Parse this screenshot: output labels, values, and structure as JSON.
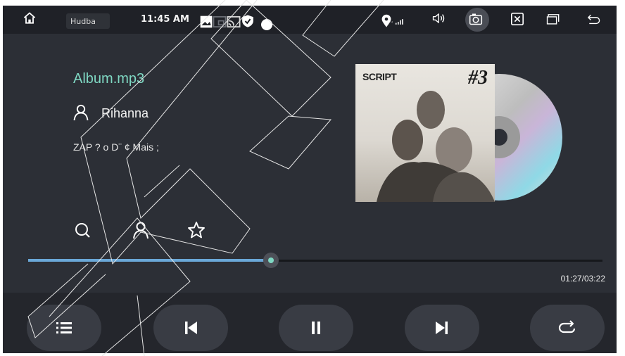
{
  "status_bar": {
    "app_label": "Hudba",
    "time": "11:45 AM",
    "icons": [
      "home-icon",
      "image-icon",
      "cast-icon",
      "screen-mirror-icon",
      "shield-icon",
      "location-icon",
      "signal-icon",
      "volume-icon",
      "camera-icon",
      "close-box-icon",
      "windows-icon",
      "back-icon"
    ]
  },
  "track": {
    "filename": "Album.mp3",
    "artist": "Rihanna",
    "album": "ZAP ? o D¨ ¢ Mais ;"
  },
  "cover": {
    "brand": "SCRIPT",
    "number": "#3"
  },
  "progress": {
    "fraction": 0.4226,
    "elapsed_total": "01:27/03:22"
  },
  "tools": [
    "search-icon",
    "artist-icon",
    "favorite-icon"
  ],
  "controls": [
    "playlist-icon",
    "previous-icon",
    "pause-icon",
    "next-icon",
    "repeat-icon"
  ],
  "colors": {
    "accent": "#7fd8c3",
    "progress": "#6aa8d8",
    "background": "#2c2f36"
  }
}
